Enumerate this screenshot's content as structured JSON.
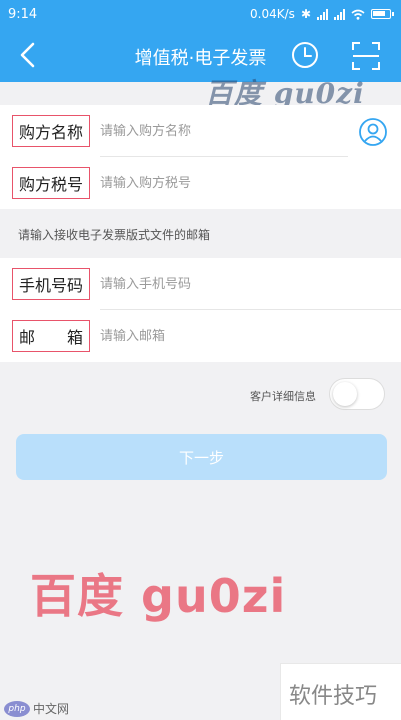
{
  "status_bar": {
    "time": "9:14",
    "speed": "0.04K/s"
  },
  "header": {
    "title": "增值税·电子发票"
  },
  "watermark_top": "百度 gu0zi",
  "form_top": {
    "buyer_name": {
      "label": "购方名称",
      "placeholder": "请输入购方名称"
    },
    "buyer_tax_no": {
      "label": "购方税号",
      "placeholder": "请输入购方税号"
    }
  },
  "hint": "请输入接收电子发票版式文件的邮箱",
  "form_contact": {
    "phone": {
      "label": "手机号码",
      "placeholder": "请输入手机号码"
    },
    "email": {
      "label_left": "邮",
      "label_right": "箱",
      "placeholder": "请输入邮箱"
    }
  },
  "customer_details": {
    "label": "客户详细信息",
    "enabled": false
  },
  "next_button": "下一步",
  "watermark_bottom": "百度 gu0zi",
  "watermark_box": "软件技巧",
  "logo": {
    "badge": "php",
    "text": "中文网"
  },
  "colors": {
    "primary": "#35a6f1",
    "button_disabled": "#b9dffb",
    "highlight": "#e8536a"
  }
}
